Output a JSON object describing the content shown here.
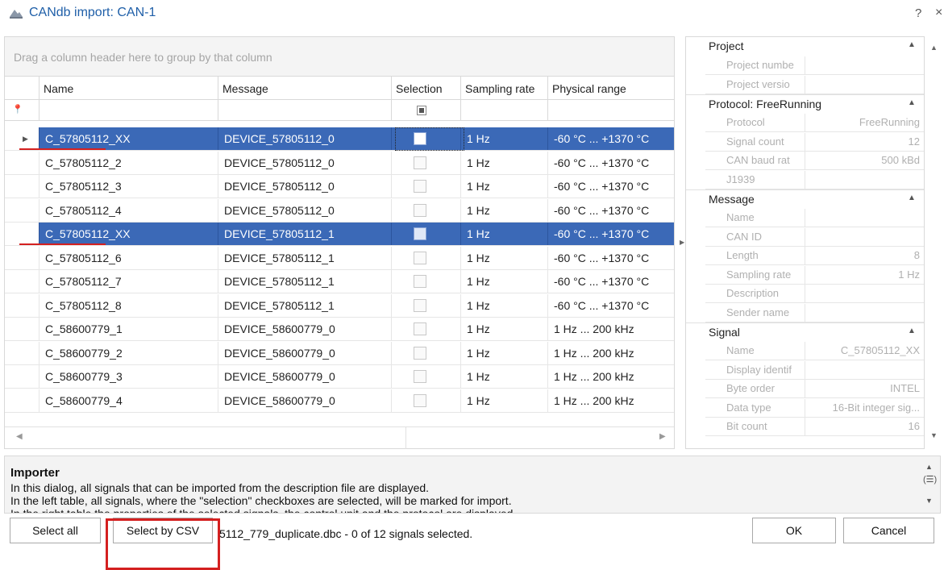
{
  "window": {
    "title": "CANdb import: CAN-1",
    "help_glyph": "?",
    "close_glyph": "×"
  },
  "grid": {
    "group_hint": "Drag a column header here to group by that column",
    "columns": [
      "Name",
      "Message",
      "Selection",
      "Sampling rate",
      "Physical range"
    ],
    "rows": [
      {
        "name": "C_57805112_XX",
        "message": "DEVICE_57805112_0",
        "rate": "1 Hz",
        "range": "-60 °C ... +1370 °C",
        "selected": true,
        "focused": true
      },
      {
        "name": "C_57805112_2",
        "message": "DEVICE_57805112_0",
        "rate": "1 Hz",
        "range": "-60 °C ... +1370 °C",
        "selected": false
      },
      {
        "name": "C_57805112_3",
        "message": "DEVICE_57805112_0",
        "rate": "1 Hz",
        "range": "-60 °C ... +1370 °C",
        "selected": false
      },
      {
        "name": "C_57805112_4",
        "message": "DEVICE_57805112_0",
        "rate": "1 Hz",
        "range": "-60 °C ... +1370 °C",
        "selected": false
      },
      {
        "name": "C_57805112_XX",
        "message": "DEVICE_57805112_1",
        "rate": "1 Hz",
        "range": "-60 °C ... +1370 °C",
        "selected": true
      },
      {
        "name": "C_57805112_6",
        "message": "DEVICE_57805112_1",
        "rate": "1 Hz",
        "range": "-60 °C ... +1370 °C",
        "selected": false
      },
      {
        "name": "C_57805112_7",
        "message": "DEVICE_57805112_1",
        "rate": "1 Hz",
        "range": "-60 °C ... +1370 °C",
        "selected": false
      },
      {
        "name": "C_57805112_8",
        "message": "DEVICE_57805112_1",
        "rate": "1 Hz",
        "range": "-60 °C ... +1370 °C",
        "selected": false
      },
      {
        "name": "C_58600779_1",
        "message": "DEVICE_58600779_0",
        "rate": "1 Hz",
        "range": "1 Hz ... 200 kHz",
        "selected": false
      },
      {
        "name": "C_58600779_2",
        "message": "DEVICE_58600779_0",
        "rate": "1 Hz",
        "range": "1 Hz ... 200 kHz",
        "selected": false
      },
      {
        "name": "C_58600779_3",
        "message": "DEVICE_58600779_0",
        "rate": "1 Hz",
        "range": "1 Hz ... 200 kHz",
        "selected": false
      },
      {
        "name": "C_58600779_4",
        "message": "DEVICE_58600779_0",
        "rate": "1 Hz",
        "range": "1 Hz ... 200 kHz",
        "selected": false
      }
    ]
  },
  "props": {
    "categories": [
      {
        "title": "Project",
        "items": [
          {
            "k": "Project numbe",
            "v": ""
          },
          {
            "k": "Project versio",
            "v": ""
          }
        ]
      },
      {
        "title": "Protocol: FreeRunning",
        "items": [
          {
            "k": "Protocol",
            "v": "FreeRunning"
          },
          {
            "k": "Signal count",
            "v": "12"
          },
          {
            "k": "CAN baud rat",
            "v": "500 kBd"
          },
          {
            "k": "J1939",
            "v": "",
            "checkbox": true
          }
        ]
      },
      {
        "title": "Message",
        "items": [
          {
            "k": "Name",
            "v": ""
          },
          {
            "k": "CAN ID",
            "v": ""
          },
          {
            "k": "Length",
            "v": "8"
          },
          {
            "k": "Sampling rate",
            "v": "1 Hz"
          },
          {
            "k": "Description",
            "v": ""
          },
          {
            "k": "Sender name",
            "v": ""
          }
        ]
      },
      {
        "title": "Signal",
        "items": [
          {
            "k": "Name",
            "v": "C_57805112_XX"
          },
          {
            "k": "Display identif",
            "v": ""
          },
          {
            "k": "Byte order",
            "v": "INTEL"
          },
          {
            "k": "Data type",
            "v": "16-Bit integer sig..."
          },
          {
            "k": "Bit count",
            "v": "16"
          }
        ]
      }
    ]
  },
  "info": {
    "title": "Importer",
    "lines": [
      "In this dialog, all signals that can be imported from the description file are displayed.",
      "In the left table, all signals, where the \"selection\" checkboxes are selected, will be marked for import.",
      "In the right table the properties of the selected signals, the control unit and the protocol are displayed."
    ]
  },
  "footer": {
    "select_all": "Select all",
    "select_csv": "Select by CSV",
    "status": "5112_779_duplicate.dbc  -  0 of 12 signals selected.",
    "ok": "OK",
    "cancel": "Cancel"
  },
  "colors": {
    "selection": "#3b69b7",
    "title": "#1f5fa8",
    "annotation": "#d42020"
  }
}
